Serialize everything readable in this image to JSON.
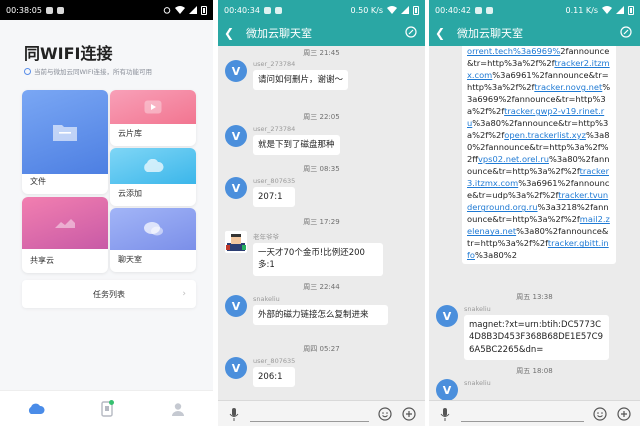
{
  "panel1": {
    "status": {
      "time": "00:38:05"
    },
    "title": "同WIFI连接",
    "subtitle": "当前与微加云同WIFI连接，所有功能可用",
    "tiles": {
      "file": "文件",
      "cloud_lib": "云片库",
      "cloud_add": "云添加",
      "share_cloud": "共享云",
      "chatroom": "聊天室"
    },
    "task_list": "任务列表",
    "colors": {
      "file": "#5b8cea",
      "cloud_lib": "#f48aa3",
      "cloud_add": "#56c3ef",
      "share": "#e26aab",
      "chat": "#8fa2f1"
    }
  },
  "panel2": {
    "status": {
      "time": "00:40:34",
      "speed": "0.50 K/s"
    },
    "title": "微加云聊天室",
    "messages": [
      {
        "time": "周三 21:45",
        "user": "user_273784",
        "text": "请问如何删片，谢谢～"
      },
      {
        "time": "周三 22:05",
        "user": "user_273784",
        "text": "就是下到了磁盘那种"
      },
      {
        "time": "周三 08:35",
        "user": "user_807635",
        "text": "207:1"
      },
      {
        "time": "周三 17:29",
        "user": "老年爷爷",
        "text": "一天才70个金币!比例还200多:1"
      },
      {
        "time": "周三 22:44",
        "user": "snakeliu",
        "text": "外部的磁力链接怎么复制进来"
      },
      {
        "time": "周四 05:27",
        "user": "user_807635",
        "text": "206:1"
      }
    ]
  },
  "panel3": {
    "status": {
      "time": "00:40:42",
      "speed": "0.11 K/s"
    },
    "title": "微加云聊天室",
    "link_lines": [
      {
        "t": "orrent.tech%3a6969%",
        "link": true
      },
      {
        "t": "2fannounce&tr=http%3a%",
        "link": false
      },
      {
        "t": "2f%2f",
        "link": false
      },
      {
        "t": "tracker2.itzmx.com",
        "link": true
      },
      {
        "t": "%3a6961%2fannounce&tr=http%3a%2f%2f",
        "link": false
      },
      {
        "t": "tracker.novg.net",
        "link": true
      },
      {
        "t": "%3a6969%2fannounce&tr=http%3a%2f%2f",
        "link": false
      },
      {
        "t": "tracker.gwp2-v19.rinet.ru",
        "link": true
      },
      {
        "t": "%3a80%2fannounce&tr=http%3a%2f%2f",
        "link": false
      },
      {
        "t": "open.trackerlist.xyz",
        "link": true
      },
      {
        "t": "%3a80%2fannounce&tr=http%3a%2f%2f",
        "link": false
      },
      {
        "t": "fvps02.net.orel.ru",
        "link": true
      },
      {
        "t": "%3a80%2fannounce&tr=http%3a%2f%2f",
        "link": false
      },
      {
        "t": "tracker3.itzmx.com",
        "link": true
      },
      {
        "t": "%3a6961%2fannounce&tr=udp%3a%2f%2f",
        "link": false
      },
      {
        "t": "tracker.tvunderground.org.ru",
        "link": true
      },
      {
        "t": "%3a3218%2fannounce&tr=http%3a%2f%2f",
        "link": false
      },
      {
        "t": "mail2.zelenaya.net",
        "link": true
      },
      {
        "t": "%3a80%2fannounce&tr=http%3a%2f%2f",
        "link": false
      },
      {
        "t": "tracker.gbitt.info",
        "link": true
      },
      {
        "t": "%3a80%2",
        "link": false
      }
    ],
    "messages": [
      {
        "time": "周五 13:38",
        "user": "snakeliu",
        "text": "magnet:?xt=urn:btih:DC5773C4D8B3D453F368B68DE1E57C96A5BC2265&dn="
      },
      {
        "time": "周五 18:08",
        "user": "snakeliu"
      }
    ]
  }
}
